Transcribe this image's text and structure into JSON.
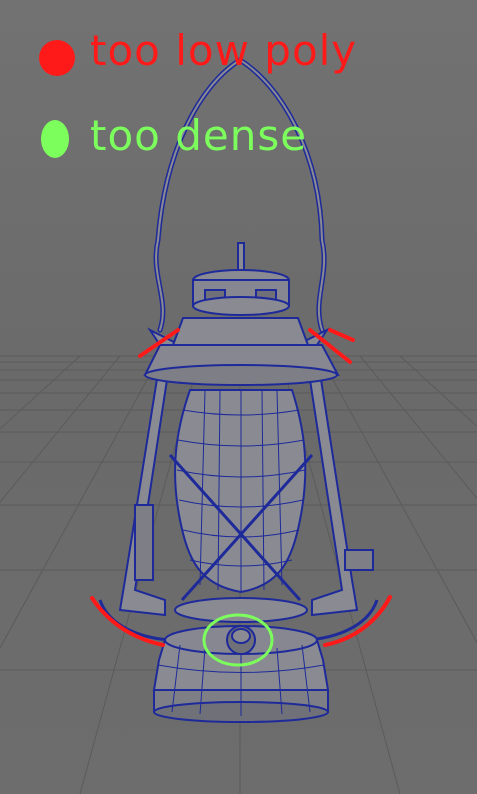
{
  "scene": {
    "viewport_bg": "#6e6e6e",
    "grid_color": "#5b5b5b",
    "mesh_fill": "#8a8b92",
    "mesh_shade": "#6f7078",
    "wire_color": "#1e2a9a"
  },
  "legend": {
    "red_label": "too low poly",
    "green_label": "too dense",
    "red_color": "#ff1a1a",
    "green_color": "#7cff5c"
  },
  "annotations": {
    "low_poly_marks": 5,
    "dense_marks": 1
  }
}
